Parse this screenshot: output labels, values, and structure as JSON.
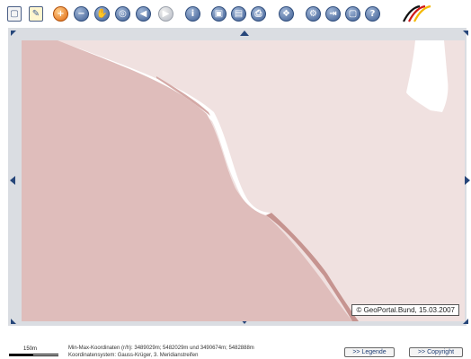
{
  "toolbar": {
    "buttons": [
      {
        "name": "new-document-icon",
        "glyph": "▢"
      },
      {
        "name": "edit-pen-icon",
        "glyph": "✎"
      },
      {
        "name": "zoom-in-icon",
        "glyph": "+"
      },
      {
        "name": "zoom-out-icon",
        "glyph": "−"
      },
      {
        "name": "pan-hand-icon",
        "glyph": "✋"
      },
      {
        "name": "zoom-box-icon",
        "glyph": "◎"
      },
      {
        "name": "back-icon",
        "glyph": "◀"
      },
      {
        "name": "forward-icon",
        "glyph": "▶"
      },
      {
        "name": "info-icon",
        "glyph": "i"
      },
      {
        "name": "save-icon",
        "glyph": "▣"
      },
      {
        "name": "download-icon",
        "glyph": "▤"
      },
      {
        "name": "print-icon",
        "glyph": "⎙"
      },
      {
        "name": "layers-icon",
        "glyph": "❖"
      },
      {
        "name": "settings-icon",
        "glyph": "⚙"
      },
      {
        "name": "export-icon",
        "glyph": "⇥"
      },
      {
        "name": "window-icon",
        "glyph": "▢"
      },
      {
        "name": "help-icon",
        "glyph": "?"
      }
    ],
    "logo_colors": [
      "#111111",
      "#d01818",
      "#f4b800"
    ]
  },
  "map": {
    "copyright": "© GeoPortal.Bund, 15.03.2007",
    "colors": {
      "background": "#f0e1e0",
      "area_dark": "#dfbdbb",
      "area_shadow": "#c69490",
      "gap": "#ffffff"
    }
  },
  "footer": {
    "scale_label": "150m",
    "coords_line1": "Min-Max-Koordinaten (r/h): 3489029m; 5482029m und 3490674m; 5482888m",
    "coords_line2": "Koordinatensystem: Gauss-Krüger, 3. Meridianstreifen",
    "legend_button": ">> Legende",
    "copyright_button": ">> Copyright"
  }
}
